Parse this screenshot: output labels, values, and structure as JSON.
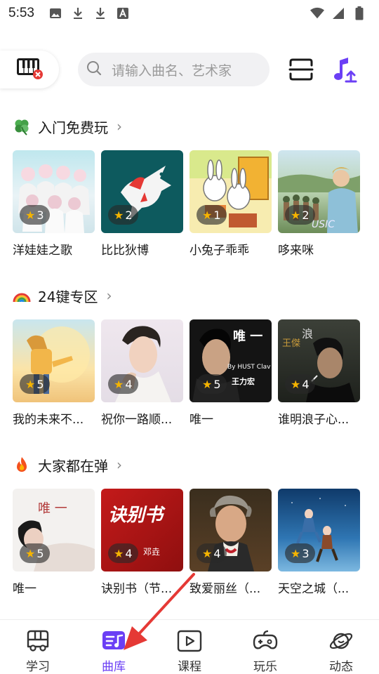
{
  "status_bar": {
    "time": "5:53",
    "left_icons": [
      "image-icon",
      "download-icon",
      "download-icon",
      "a-icon"
    ],
    "right_icons": [
      "wifi-icon",
      "signal-icon",
      "battery-icon"
    ]
  },
  "header": {
    "search_placeholder": "请输入曲名、艺术家"
  },
  "sections": [
    {
      "title": "入门免费玩",
      "emoji": "clover-icon",
      "items": [
        {
          "title": "洋娃娃之歌",
          "rating": "3"
        },
        {
          "title": "比比狄博",
          "rating": "2"
        },
        {
          "title": "小兔子乖乖",
          "rating": "1"
        },
        {
          "title": "哆来咪",
          "rating": "2"
        }
      ]
    },
    {
      "title": "24键专区",
      "emoji": "rainbow-icon",
      "items": [
        {
          "title": "我的未来不...",
          "rating": "5"
        },
        {
          "title": "祝你一路顺...",
          "rating": "4"
        },
        {
          "title": "唯一",
          "rating": "5"
        },
        {
          "title": "谁明浪子心...",
          "rating": "4"
        }
      ]
    },
    {
      "title": "大家都在弹",
      "emoji": "fire-icon",
      "items": [
        {
          "title": "唯一",
          "rating": "5"
        },
        {
          "title": "诀别书（节...",
          "rating": "4"
        },
        {
          "title": "致爱丽丝（...",
          "rating": "4"
        },
        {
          "title": "天空之城（...",
          "rating": "3"
        }
      ]
    }
  ],
  "cover_text": {
    "wei_yi_tag": "唯 一",
    "wei_yi_sub": "By HUST Clav",
    "wang_lee_hom": "王力宏",
    "wang_jie": "王傑",
    "lang": "浪",
    "wei_yi_cover": "唯 一",
    "jue_bie_shu": "诀别书",
    "deng_tong": "邓垚",
    "music_caption": "USIC"
  },
  "bottom_nav": {
    "items": [
      {
        "label": "学习",
        "icon": "bus-icon"
      },
      {
        "label": "曲库",
        "icon": "music-library-icon",
        "active": true
      },
      {
        "label": "课程",
        "icon": "video-icon"
      },
      {
        "label": "玩乐",
        "icon": "gamepad-icon"
      },
      {
        "label": "动态",
        "icon": "planet-icon"
      }
    ]
  },
  "colors": {
    "accent": "#6b3ff5",
    "star": "#f5b400",
    "annotation": "#e53935"
  }
}
